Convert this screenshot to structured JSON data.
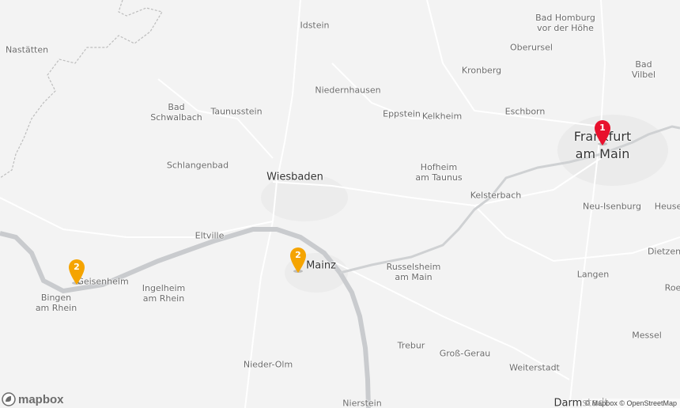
{
  "map": {
    "places": [
      {
        "id": "nastatten",
        "label": "Nastätten"
      },
      {
        "id": "idstein",
        "label": "Idstein"
      },
      {
        "id": "bad-homburg",
        "label": "Bad Homburg\nvor der Höhe"
      },
      {
        "id": "oberursel",
        "label": "Oberursel"
      },
      {
        "id": "bad-vilbel",
        "label": "Bad Vilbel"
      },
      {
        "id": "kronberg",
        "label": "Kronberg"
      },
      {
        "id": "niedernhausen",
        "label": "Niedernhausen"
      },
      {
        "id": "bad-schwalbach",
        "label": "Bad\nSchwalbach"
      },
      {
        "id": "taunusstein",
        "label": "Taunusstein"
      },
      {
        "id": "eppstein",
        "label": "Eppstein"
      },
      {
        "id": "kelkheim",
        "label": "Kelkheim"
      },
      {
        "id": "eschborn",
        "label": "Eschborn"
      },
      {
        "id": "frankfurt",
        "label": "Frankfurt\nam Main"
      },
      {
        "id": "schlangenbad",
        "label": "Schlangenbad"
      },
      {
        "id": "wiesbaden",
        "label": "Wiesbaden"
      },
      {
        "id": "hofheim",
        "label": "Hofheim\nam Taunus"
      },
      {
        "id": "kelsterbach",
        "label": "Kelsterbach"
      },
      {
        "id": "neu-isenburg",
        "label": "Neu-Isenburg"
      },
      {
        "id": "heuse",
        "label": "Heuse"
      },
      {
        "id": "eltville",
        "label": "Eltville"
      },
      {
        "id": "mainz",
        "label": "Mainz"
      },
      {
        "id": "russelsheim",
        "label": "Russelsheim\nam Main"
      },
      {
        "id": "dietzen",
        "label": "Dietzen"
      },
      {
        "id": "geisenheim",
        "label": "Geisenheim"
      },
      {
        "id": "ingelheim",
        "label": "Ingelheim\nam Rhein"
      },
      {
        "id": "bingen",
        "label": "Bingen\nam Rhein"
      },
      {
        "id": "langen",
        "label": "Langen"
      },
      {
        "id": "roe",
        "label": "Roe"
      },
      {
        "id": "trebur",
        "label": "Trebur"
      },
      {
        "id": "gross-gerau",
        "label": "Groß-Gerau"
      },
      {
        "id": "messel",
        "label": "Messel"
      },
      {
        "id": "nieder-olm",
        "label": "Nieder-Olm"
      },
      {
        "id": "weiterstadt",
        "label": "Weiterstadt"
      },
      {
        "id": "nierstein",
        "label": "Nierstein"
      },
      {
        "id": "darmstadt",
        "label": "Darmstadt"
      }
    ],
    "markers": [
      {
        "id": "cluster-geisenheim",
        "count": "2",
        "color": "#f5a400",
        "icon": "map-pin-icon"
      },
      {
        "id": "cluster-mainz",
        "count": "2",
        "color": "#f5a400",
        "icon": "map-pin-icon"
      },
      {
        "id": "marker-frankfurt",
        "count": "1",
        "color": "#e8112d",
        "icon": "map-pin-icon"
      }
    ],
    "colors": {
      "background": "#f3f3f3",
      "water": "#c9cbce",
      "road": "#ffffff",
      "border": "#bfbfbf"
    }
  },
  "logo": {
    "text": "mapbox",
    "icon": "mapbox-logo-icon"
  },
  "attribution": {
    "text": "© Mapbox © OpenStreetMap"
  }
}
